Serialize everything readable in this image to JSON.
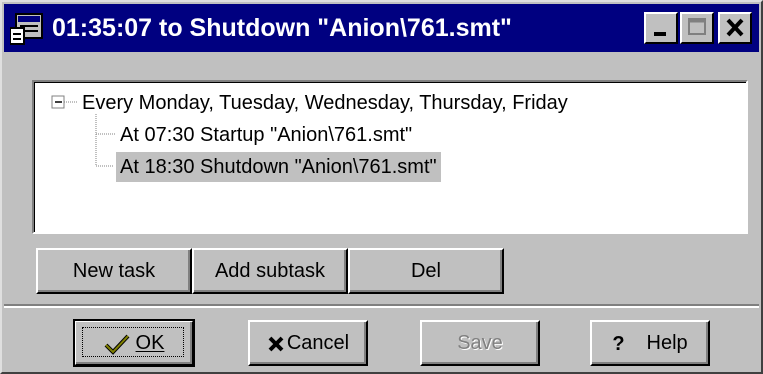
{
  "window": {
    "title": "01:35:07 to Shutdown \"Anion\\761.smt\""
  },
  "tree": {
    "root": "Every Monday, Tuesday, Wednesday, Thursday, Friday",
    "children": [
      "At 07:30 Startup \"Anion\\761.smt\"",
      "At 18:30 Shutdown \"Anion\\761.smt\""
    ],
    "selected_index": 1
  },
  "task_buttons": {
    "new_task": "New task",
    "add_subtask": "Add subtask",
    "del": "Del"
  },
  "dialog_buttons": {
    "ok": "OK",
    "cancel": "Cancel",
    "save": "Save",
    "help": "Help"
  },
  "colors": {
    "titlebar": "#000080",
    "face": "#c0c0c0",
    "selection": "#c0c0c0"
  }
}
